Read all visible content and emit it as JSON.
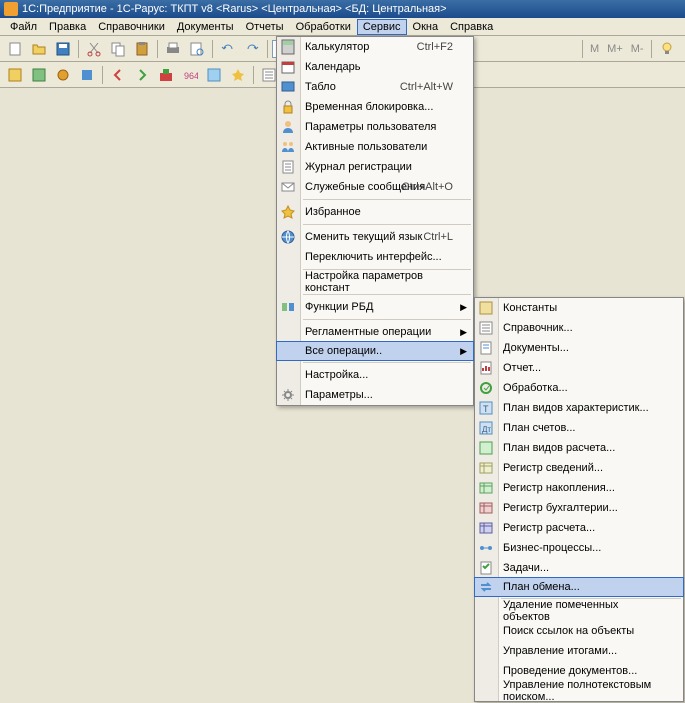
{
  "title": "1С:Предприятие - 1C-Рарус: ТКПТ v8 <Rarus> <Центральная> <БД: Центральная>",
  "menubar": {
    "file": "Файл",
    "edit": "Правка",
    "catalogs": "Справочники",
    "documents": "Документы",
    "reports": "Отчеты",
    "processing": "Обработки",
    "service": "Сервис",
    "windows": "Окна",
    "help": "Справка"
  },
  "toolbar2": {
    "m": "M",
    "mplus": "M+",
    "mminus": "M-"
  },
  "serviceMenu": [
    {
      "label": "Калькулятор",
      "shortcut": "Ctrl+F2",
      "icon": "calc"
    },
    {
      "label": "Календарь",
      "icon": "calendar"
    },
    {
      "label": "Табло",
      "shortcut": "Ctrl+Alt+W",
      "icon": "board"
    },
    {
      "label": "Временная блокировка...",
      "icon": "lock"
    },
    {
      "label": "Параметры пользователя",
      "icon": "userparam"
    },
    {
      "label": "Активные пользователи",
      "icon": "users"
    },
    {
      "label": "Журнал регистрации",
      "icon": "journal"
    },
    {
      "label": "Служебные сообщения",
      "shortcut": "Ctrl+Alt+O",
      "icon": "msg"
    },
    {
      "sep": true
    },
    {
      "label": "Избранное",
      "icon": "star"
    },
    {
      "sep": true
    },
    {
      "label": "Сменить текущий язык",
      "shortcut": "Ctrl+L",
      "icon": "lang"
    },
    {
      "label": "Переключить интерфейс..."
    },
    {
      "sep": true
    },
    {
      "label": "Настройка параметров констант"
    },
    {
      "sep": true
    },
    {
      "label": "Функции РБД",
      "icon": "rbd",
      "arrow": true
    },
    {
      "sep": true
    },
    {
      "label": "Регламентные операции",
      "arrow": true
    },
    {
      "label": "Все операции..",
      "arrow": true,
      "hl": true
    },
    {
      "sep": true
    },
    {
      "label": "Настройка..."
    },
    {
      "label": "Параметры...",
      "icon": "params"
    }
  ],
  "allOpsMenu": [
    {
      "label": "Константы",
      "icon": "const"
    },
    {
      "label": "Справочник...",
      "icon": "catalog"
    },
    {
      "label": "Документы...",
      "icon": "doc"
    },
    {
      "label": "Отчет...",
      "icon": "report"
    },
    {
      "label": "Обработка...",
      "icon": "proc"
    },
    {
      "label": "План видов характеристик...",
      "icon": "plan1"
    },
    {
      "label": "План счетов...",
      "icon": "plan2"
    },
    {
      "label": "План видов расчета...",
      "icon": "plan3"
    },
    {
      "label": "Регистр сведений...",
      "icon": "reg1"
    },
    {
      "label": "Регистр накопления...",
      "icon": "reg2"
    },
    {
      "label": "Регистр бухгалтерии...",
      "icon": "reg3"
    },
    {
      "label": "Регистр расчета...",
      "icon": "reg4"
    },
    {
      "label": "Бизнес-процессы...",
      "icon": "bp"
    },
    {
      "label": "Задачи...",
      "icon": "task"
    },
    {
      "label": "План обмена...",
      "icon": "exchange",
      "hl": true
    },
    {
      "sep": true
    },
    {
      "label": "Удаление помеченных объектов"
    },
    {
      "label": "Поиск ссылок на объекты"
    },
    {
      "label": "Управление итогами..."
    },
    {
      "label": "Проведение документов..."
    },
    {
      "label": "Управление полнотекстовым поиском..."
    }
  ]
}
